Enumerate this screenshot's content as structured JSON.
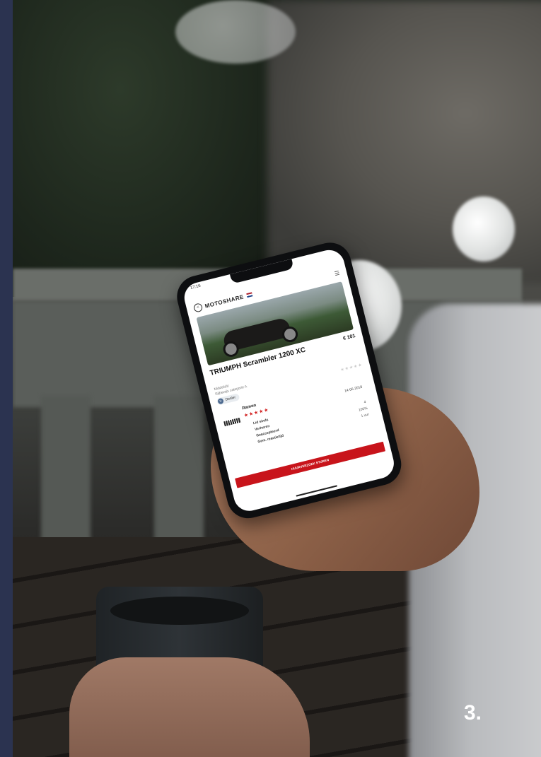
{
  "phone": {
    "status_time": "17:16",
    "status_right": "",
    "url": "",
    "brand": "MOTOSHARE",
    "listing_title": "TRIUMPH Scrambler 1200 XC",
    "price": "€ 101",
    "price_sub": "",
    "subtitle_1": "Middelzitt",
    "subtitle_2": "Rijbewijs categorie A",
    "dealer_badge": "Dealer",
    "seller_name": "Ramon",
    "seller_stars": "★★★★★",
    "grey_stars": "★★★★★",
    "seller_date": "14-06-2018",
    "info_rows": [
      {
        "key": "Lid sinds",
        "value": ""
      },
      {
        "key": "Verhuren",
        "value": "4"
      },
      {
        "key": "Geaccepteerd",
        "value": "100%"
      },
      {
        "key": "Gem. reactietijd",
        "value": "1 uur"
      }
    ],
    "cta_label": "HUURVERZOEK STUREN",
    "disclaimer": ""
  },
  "step_label": "3."
}
